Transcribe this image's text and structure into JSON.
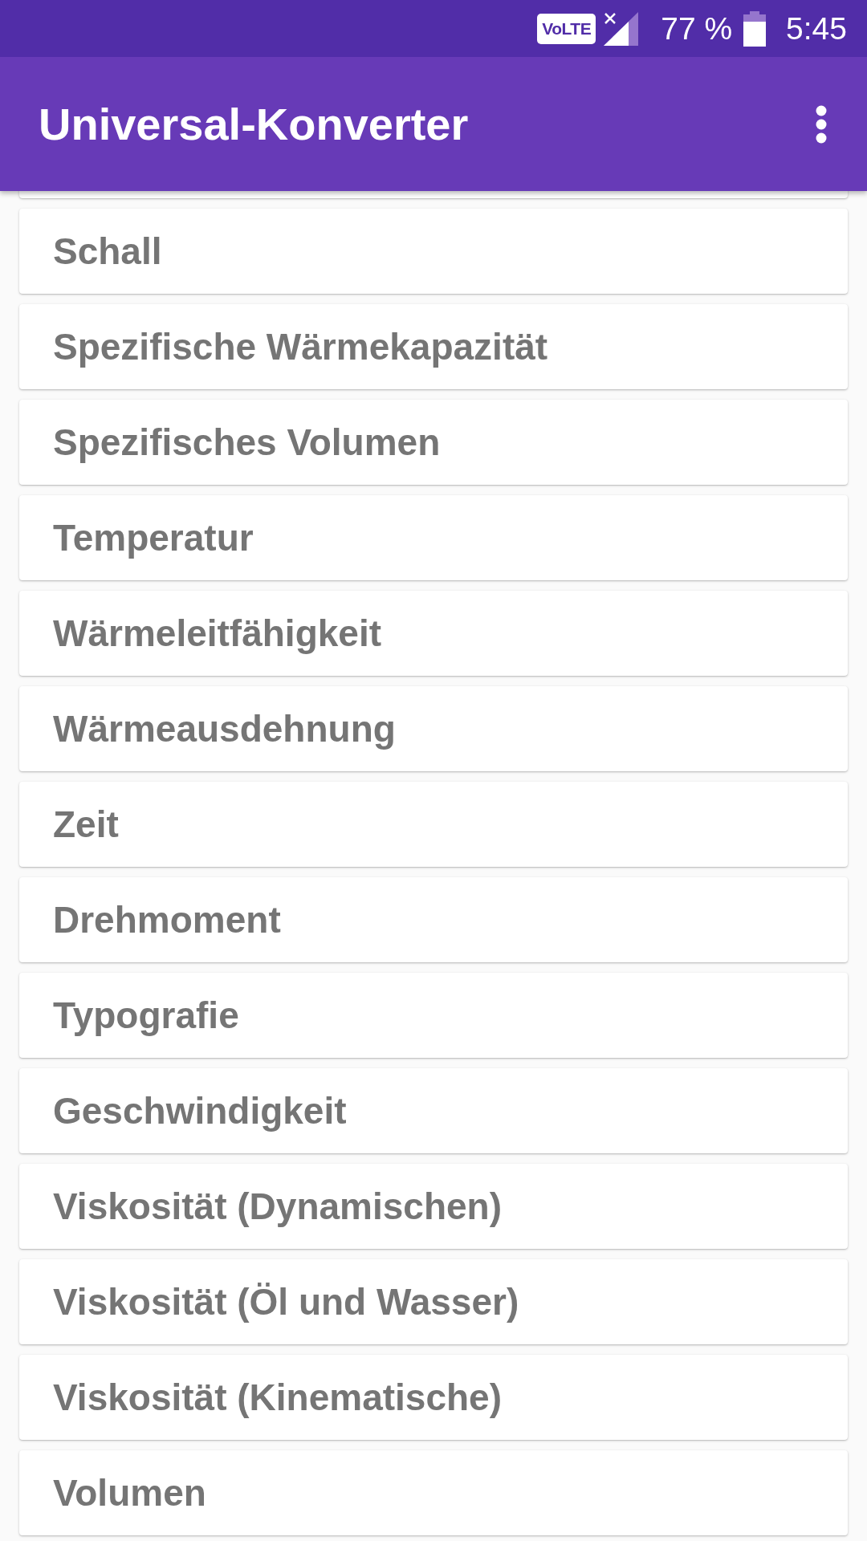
{
  "status_bar": {
    "network_label": "VoLTE",
    "battery_percent": "77 %",
    "time": "5:45"
  },
  "app_bar": {
    "title": "Universal-Konverter"
  },
  "categories": [
    {
      "label": "Schall"
    },
    {
      "label": "Spezifische Wärmekapazität"
    },
    {
      "label": "Spezifisches Volumen"
    },
    {
      "label": "Temperatur"
    },
    {
      "label": "Wärmeleitfähigkeit"
    },
    {
      "label": "Wärmeausdehnung"
    },
    {
      "label": "Zeit"
    },
    {
      "label": "Drehmoment"
    },
    {
      "label": "Typografie"
    },
    {
      "label": "Geschwindigkeit"
    },
    {
      "label": "Viskosität (Dynamischen)"
    },
    {
      "label": "Viskosität (Öl und Wasser)"
    },
    {
      "label": "Viskosität (Kinematische)"
    },
    {
      "label": "Volumen"
    }
  ]
}
